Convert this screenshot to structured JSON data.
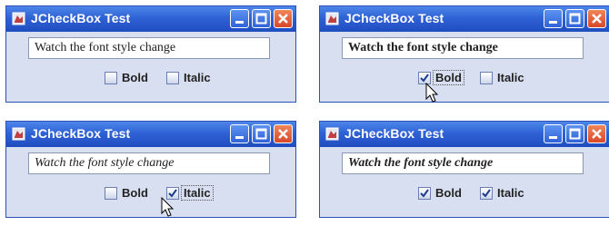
{
  "windows": [
    {
      "title": "JCheckBox Test",
      "text": "Watch the font style change",
      "bold_label": "Bold",
      "italic_label": "Italic",
      "bold_checked": false,
      "italic_checked": false
    },
    {
      "title": "JCheckBox Test",
      "text": "Watch the font style change",
      "bold_label": "Bold",
      "italic_label": "Italic",
      "bold_checked": true,
      "italic_checked": false
    },
    {
      "title": "JCheckBox Test",
      "text": "Watch the font style change",
      "bold_label": "Bold",
      "italic_label": "Italic",
      "bold_checked": false,
      "italic_checked": true
    },
    {
      "title": "JCheckBox Test",
      "text": "Watch the font style change",
      "bold_label": "Bold",
      "italic_label": "Italic",
      "bold_checked": true,
      "italic_checked": true
    }
  ],
  "colors": {
    "titlebar": "#2f62d6",
    "window_bg": "#d8dff0",
    "close_button": "#d8482a"
  },
  "icons": [
    "java-app-icon",
    "minimize-icon",
    "maximize-icon",
    "close-icon",
    "checkmark-icon",
    "mouse-pointer-icon"
  ]
}
